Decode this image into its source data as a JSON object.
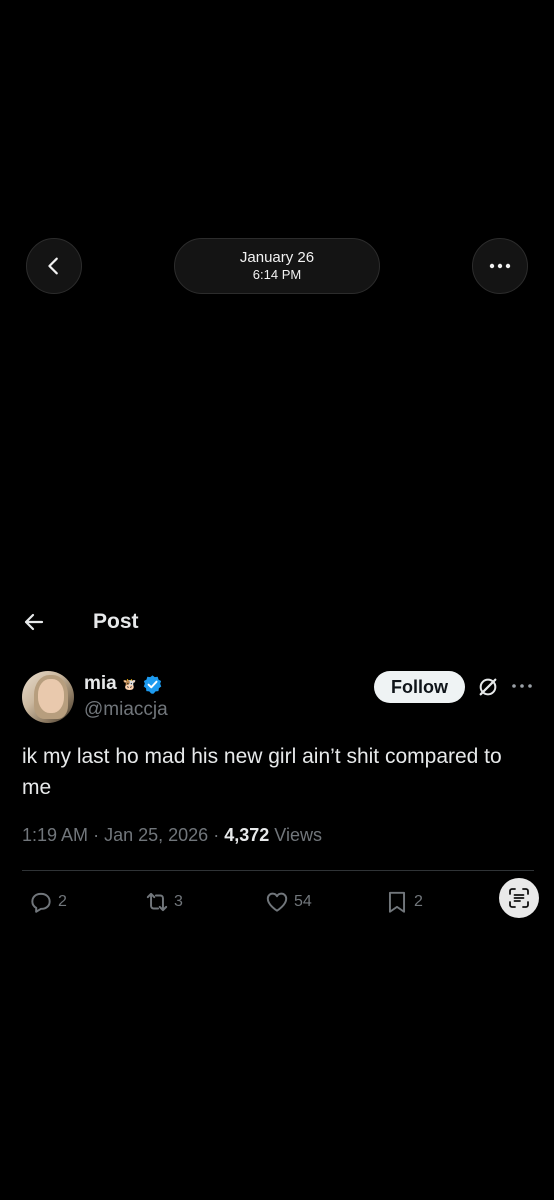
{
  "viewer": {
    "date": "January 26",
    "time": "6:14 PM"
  },
  "post_header": {
    "title": "Post"
  },
  "author": {
    "display_name": "mia",
    "name_emoji": "🐮",
    "handle": "@miaccja",
    "verified_color": "#1d9bf0"
  },
  "follow_label": "Follow",
  "tweet": {
    "text": "ik my last ho mad his new girl ain’t shit compared to me",
    "time": "1:19 AM",
    "separator": "·",
    "date": "Jan 25, 2026",
    "views_count": "4,372",
    "views_label": "Views"
  },
  "actions": {
    "replies": "2",
    "reposts": "3",
    "likes": "54",
    "bookmarks": "2"
  },
  "icons": [
    "chevron-left-icon",
    "more-horizontal-icon",
    "arrow-left-icon",
    "verified-badge-icon",
    "grok-icon",
    "reply-icon",
    "repost-icon",
    "like-icon",
    "bookmark-icon",
    "text-scan-icon"
  ]
}
